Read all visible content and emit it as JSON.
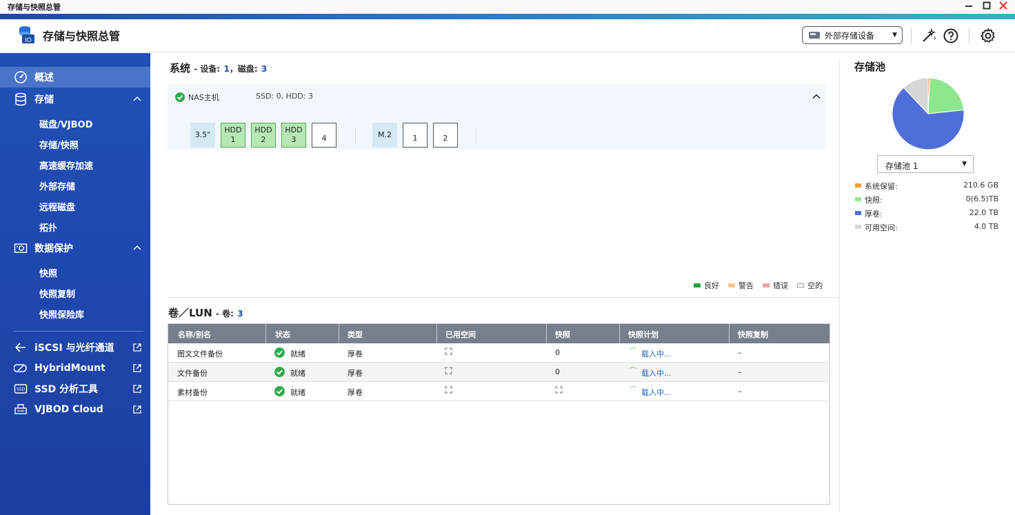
{
  "window": {
    "title": "存储与快照总管",
    "controls": [
      "minimize",
      "maximize",
      "close"
    ]
  },
  "header": {
    "app_title": "存储与快照总管",
    "external_device_label": "外部存储设备"
  },
  "sidebar": {
    "items": [
      {
        "label": "概述",
        "icon": "overview-icon",
        "active": true
      },
      {
        "label": "存储",
        "icon": "storage-icon",
        "expanded": true,
        "children": [
          "磁盘/VJBOD",
          "存储/快照",
          "高速缓存加速",
          "外部存储",
          "远程磁盘",
          "拓扑"
        ]
      },
      {
        "label": "数据保护",
        "icon": "data-protection-icon",
        "expanded": true,
        "children": [
          "快照",
          "快照复制",
          "快照保险库"
        ]
      }
    ],
    "external_links": [
      {
        "label": "iSCSI 与光纤通道",
        "icon": "iscsi-icon"
      },
      {
        "label": "HybridMount",
        "icon": "hybridmount-icon"
      },
      {
        "label": "SSD 分析工具",
        "icon": "ssd-icon"
      },
      {
        "label": "VJBOD Cloud",
        "icon": "vjbod-cloud-icon"
      }
    ]
  },
  "system": {
    "title": "系统",
    "devices_label": "- 设备:",
    "devices": "1",
    "disks_label": "，磁盘:",
    "disks": "3",
    "host_name": "NAS主机",
    "disk_counts": "SSD: 0, HDD: 3",
    "bay_35_label": "3.5\"",
    "bays_35": [
      {
        "type": "HDD",
        "num": "1",
        "state": "good"
      },
      {
        "type": "HDD",
        "num": "2",
        "state": "good"
      },
      {
        "type": "HDD",
        "num": "3",
        "state": "good"
      },
      {
        "type": "",
        "num": "4",
        "state": "empty"
      }
    ],
    "bay_m2_label": "M.2",
    "bays_m2": [
      {
        "type": "",
        "num": "1",
        "state": "empty"
      },
      {
        "type": "",
        "num": "2",
        "state": "empty"
      }
    ],
    "legend": [
      {
        "label": "良好",
        "color": "#1fa83a"
      },
      {
        "label": "警告",
        "color": "#f3c98b"
      },
      {
        "label": "错误",
        "color": "#eea3a3"
      },
      {
        "label": "空的",
        "color": "#ffffff"
      }
    ]
  },
  "volumes": {
    "title": "卷／LUN",
    "count_label": "- 卷:",
    "count": "3",
    "columns": [
      "名称/别名",
      "状态",
      "类型",
      "已用空间",
      "快照",
      "快照计划",
      "快照复制"
    ],
    "rows": [
      {
        "name": "图文文件备份",
        "status": "就绪",
        "type": "厚卷",
        "snapshots": "0",
        "schedule": "载入中...",
        "replication": "–",
        "snapshot_loading": false
      },
      {
        "name": "文件备份",
        "status": "就绪",
        "type": "厚卷",
        "snapshots": "0",
        "schedule": "载入中...",
        "replication": "–",
        "snapshot_loading": false
      },
      {
        "name": "素材备份",
        "status": "就绪",
        "type": "厚卷",
        "snapshots": "",
        "schedule": "载入中...",
        "replication": "–",
        "snapshot_loading": true
      }
    ]
  },
  "storage_pool": {
    "title": "存储池",
    "selected": "存储池 1",
    "legend": [
      {
        "label": "系统保留:",
        "value": "210.6 GB",
        "color": "#f39a3a"
      },
      {
        "label": "快照:",
        "value": "0(6.5)TB",
        "color": "#8ee78c"
      },
      {
        "label": "厚卷:",
        "value": "22.0 TB",
        "color": "#4f6fd8"
      },
      {
        "label": "可用空间:",
        "value": "4.0 TB",
        "color": "#d6d6d6"
      }
    ],
    "pie_fractions": {
      "system_reserved": 0.008,
      "snapshot": 0.225,
      "thick_volume": 0.647,
      "free": 0.12
    }
  }
}
